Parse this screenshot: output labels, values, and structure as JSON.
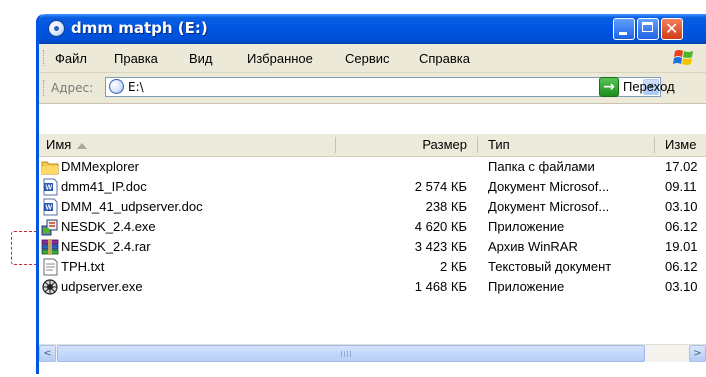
{
  "window": {
    "title": "dmm matph (E:)"
  },
  "titlebar": {
    "close_glyph": "✕"
  },
  "menubar": {
    "items": [
      "Файл",
      "Правка",
      "Вид",
      "Избранное",
      "Сервис",
      "Справка"
    ]
  },
  "address_bar": {
    "label": "Адрес:",
    "value": "E:\\",
    "go_label": "Переход",
    "go_glyph": "→",
    "dropdown_glyph": "▾"
  },
  "columns": {
    "name": "Имя",
    "size": "Размер",
    "type": "Тип",
    "date": "Изме"
  },
  "files": [
    {
      "name": "DMMexplorer",
      "size": "",
      "type": "Папка с файлами",
      "date": "17.02",
      "icon": "folder-icon"
    },
    {
      "name": "dmm41_IP.doc",
      "size": "2 574 КБ",
      "type": "Документ Microsof...",
      "date": "09.11",
      "icon": "word-document-icon"
    },
    {
      "name": "DMM_41_udpserver.doc",
      "size": "238 КБ",
      "type": "Документ Microsof...",
      "date": "03.10",
      "icon": "word-document-icon"
    },
    {
      "name": "NESDK_2.4.exe",
      "size": "4 620 КБ",
      "type": "Приложение",
      "date": "06.12",
      "icon": "installer-icon"
    },
    {
      "name": "NESDK_2.4.rar",
      "size": "3 423 КБ",
      "type": "Архив WinRAR",
      "date": "19.01",
      "icon": "winrar-archive-icon"
    },
    {
      "name": "TPH.txt",
      "size": "2 КБ",
      "type": "Текстовый документ",
      "date": "06.12",
      "icon": "text-file-icon"
    },
    {
      "name": "udpserver.exe",
      "size": "1 468 КБ",
      "type": "Приложение",
      "date": "03.10",
      "icon": "application-icon"
    }
  ],
  "scrollbar": {
    "left_glyph": "<",
    "right_glyph": ">"
  },
  "colors": {
    "titlebar": "#0054e3",
    "toolbar_bg": "#ece9d8",
    "highlight_dash": "#c62828",
    "go_green": "#1c8f1c"
  }
}
